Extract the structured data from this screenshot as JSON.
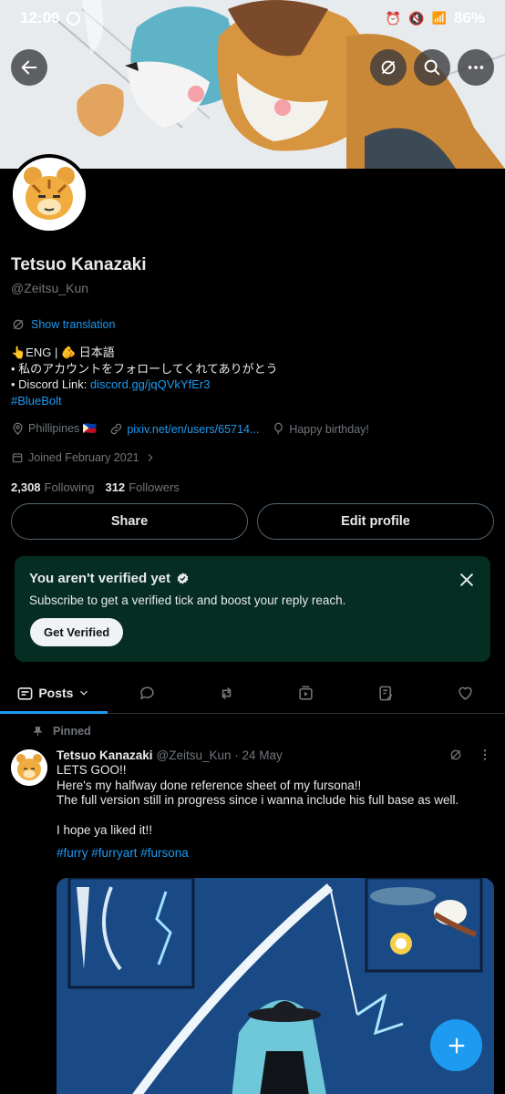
{
  "status_bar": {
    "time": "12:09",
    "battery": "86%"
  },
  "profile": {
    "name": "Tetsuo Kanazaki",
    "handle": "@Zeitsu_Kun",
    "show_translation": "Show translation",
    "bio_line1": "👆ENG | 🫵 日本語",
    "bio_line2": "• 私のアカウントをフォローしてくれてありがとう",
    "bio_line3_prefix": "• Discord Link: ",
    "bio_line3_link": "discord.gg/jqQVkYfEr3",
    "bio_hashtag": "#BlueBolt",
    "location": "Phillipines 🇵🇭",
    "website": "pixiv.net/en/users/65714...",
    "birthday": "Happy birthday!",
    "joined": "Joined February 2021",
    "following_count": "2,308",
    "following_label": "Following",
    "followers_count": "312",
    "followers_label": "Followers"
  },
  "buttons": {
    "share": "Share",
    "edit_profile": "Edit profile"
  },
  "verify_card": {
    "title": "You aren't verified yet",
    "text": "Subscribe to get a verified tick and boost your reply reach.",
    "button": "Get Verified"
  },
  "tabs": {
    "posts": "Posts"
  },
  "post": {
    "pinned": "Pinned",
    "author": "Tetsuo Kanazaki",
    "meta": "@Zeitsu_Kun · 24 May",
    "lines": [
      "LETS GOO!!",
      "Here's my halfway done reference sheet of my fursona!!",
      "The full version still in progress since i wanna include his full base as well.",
      "",
      "I hope ya liked it!!"
    ],
    "hashtags": "#furry #furryart #fursona"
  },
  "colors": {
    "accent": "#1d9bf0",
    "card_bg": "#062d22",
    "bg": "#000000"
  }
}
